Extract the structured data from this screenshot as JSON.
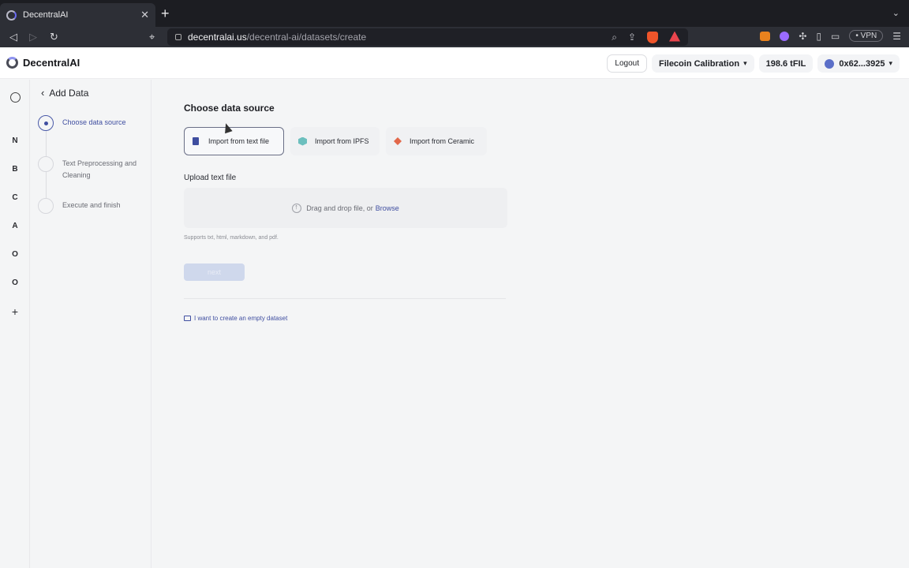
{
  "browser": {
    "tab_title": "DecentralAI",
    "tab_close": "✕",
    "new_tab": "+",
    "tab_list": "⌄",
    "back": "◁",
    "forward": "▷",
    "reload": "↻",
    "bookmark": "⌖",
    "url_host": "decentralai.us",
    "url_path": "/decentral-ai/datasets/create",
    "vpn_label": "• VPN",
    "menu": "☰"
  },
  "header": {
    "app_name": "DecentralAI",
    "logout": "Logout",
    "network": "Filecoin Calibration",
    "balance": "198.6 tFIL",
    "wallet": "0x62...3925"
  },
  "rail": {
    "items": [
      "N",
      "B",
      "C",
      "A",
      "O",
      "O",
      "+"
    ]
  },
  "stepper": {
    "back_label": "Add Data",
    "steps": [
      {
        "label": "Choose data source",
        "state": "active"
      },
      {
        "label": "Text Preprocessing and Cleaning",
        "state": "pending"
      },
      {
        "label": "Execute and finish",
        "state": "pending"
      }
    ]
  },
  "main": {
    "choose_title": "Choose data source",
    "sources": [
      {
        "label": "Import from text file",
        "icon": "document-icon",
        "selected": true
      },
      {
        "label": "Import from IPFS",
        "icon": "ipfs-icon",
        "selected": false
      },
      {
        "label": "Import from Ceramic",
        "icon": "ceramic-icon",
        "selected": false
      }
    ],
    "upload_title": "Upload text file",
    "drop_text": "Drag and drop file, or",
    "browse_link": "Browse",
    "supports": "Supports txt, html, markdown, and pdf.",
    "next_label": "next",
    "empty_dataset_link": "I want to create an empty dataset"
  },
  "colors": {
    "accent": "#3f4ea0",
    "background": "#f4f5f6",
    "chrome": "#1c1d22"
  }
}
